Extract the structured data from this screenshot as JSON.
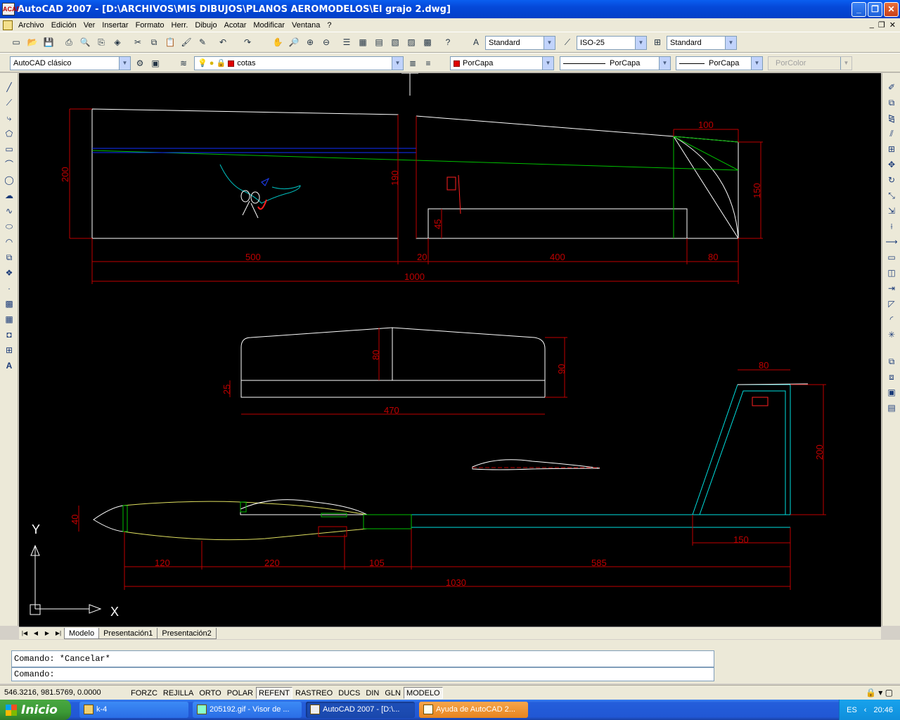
{
  "window": {
    "title": "AutoCAD 2007 - [D:\\ARCHIVOS\\MIS DIBUJOS\\PLANOS AEROMODELOS\\El grajo 2.dwg]",
    "app_icon": "ACAD"
  },
  "menu": [
    "Archivo",
    "Edición",
    "Ver",
    "Insertar",
    "Formato",
    "Herr.",
    "Dibujo",
    "Acotar",
    "Modificar",
    "Ventana",
    "?"
  ],
  "toolbar1": {
    "text_style": "Standard",
    "dim_style": "ISO-25",
    "table_style": "Standard"
  },
  "toolbar2": {
    "workspace": "AutoCAD clásico",
    "layer": "cotas",
    "color": "PorCapa",
    "linetype": "PorCapa",
    "lineweight": "PorCapa",
    "plotstyle": "PorColor"
  },
  "drawing": {
    "dims_top": [
      "500",
      "20",
      "400",
      "80",
      "1000",
      "200",
      "190",
      "45",
      "100",
      "150"
    ],
    "dims_mid": [
      "80",
      "90",
      "25",
      "470"
    ],
    "dims_bottom": [
      "40",
      "120",
      "220",
      "105",
      "585",
      "1030",
      "80",
      "200",
      "150"
    ],
    "ucs": {
      "x": "X",
      "y": "Y"
    }
  },
  "layout_tabs": [
    "Modelo",
    "Presentación1",
    "Presentación2"
  ],
  "command": {
    "history": "Comando: *Cancelar*",
    "prompt": "Comando:"
  },
  "status": {
    "coords": "546.3216, 981.5769, 0.0000",
    "buttons": [
      "FORZC",
      "REJILLA",
      "ORTO",
      "POLAR",
      "REFENT",
      "RASTREO",
      "DUCS",
      "DIN",
      "GLN",
      "MODELO"
    ]
  },
  "taskbar": {
    "start": "Inicio",
    "tasks": [
      "k-4",
      "205192.gif - Visor de ...",
      "AutoCAD 2007 - [D:\\...",
      "Ayuda de AutoCAD 2..."
    ],
    "lang": "ES",
    "time": "20:46"
  }
}
